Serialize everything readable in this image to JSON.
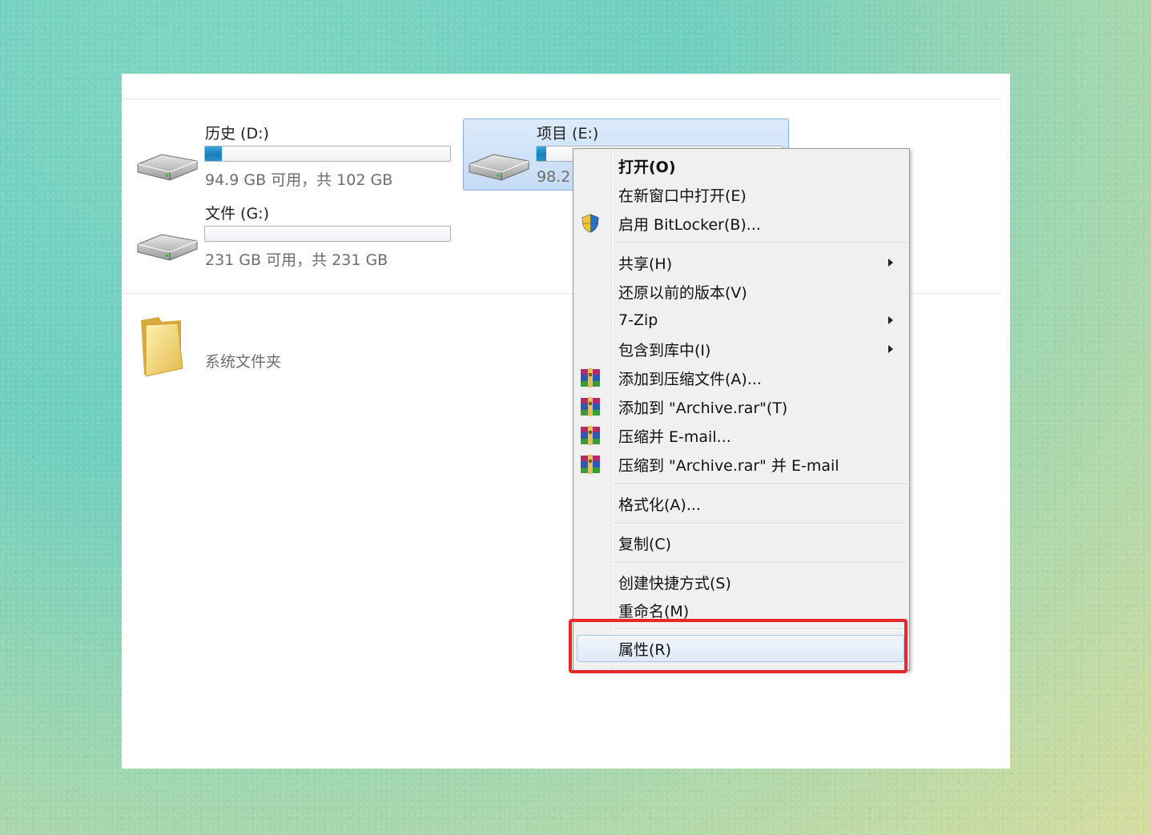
{
  "drives": [
    {
      "id": "d",
      "name": "历史 (D:)",
      "capacity": "94.9 GB 可用，共 102 GB",
      "used_fraction": 0.07
    },
    {
      "id": "g",
      "name": "文件 (G:)",
      "capacity": "231 GB 可用，共 231 GB",
      "used_fraction": 0.0
    },
    {
      "id": "e",
      "name": "项目 (E:)",
      "capacity_partial": "98.2",
      "used_fraction": 0.04,
      "selected": true
    }
  ],
  "folder": {
    "label": "系统文件夹"
  },
  "context_menu": {
    "items": [
      {
        "key": "open",
        "label": "打开(O)",
        "bold": true
      },
      {
        "key": "open_new_window",
        "label": "在新窗口中打开(E)"
      },
      {
        "key": "bitlocker",
        "label": "启用 BitLocker(B)...",
        "icon": "shield-icon"
      },
      {
        "key": "share",
        "label": "共享(H)",
        "submenu": true
      },
      {
        "key": "restore",
        "label": "还原以前的版本(V)"
      },
      {
        "key": "zip",
        "label": "7-Zip",
        "submenu": true
      },
      {
        "key": "library",
        "label": "包含到库中(I)",
        "submenu": true
      },
      {
        "key": "add_archive",
        "label": "添加到压缩文件(A)...",
        "icon": "winrar-icon"
      },
      {
        "key": "add_rar",
        "label": "添加到 \"Archive.rar\"(T)",
        "icon": "winrar-icon"
      },
      {
        "key": "compress_email",
        "label": "压缩并 E-mail...",
        "icon": "winrar-icon"
      },
      {
        "key": "compress_rar_email",
        "label": "压缩到 \"Archive.rar\" 并 E-mail",
        "icon": "winrar-icon"
      },
      {
        "key": "format",
        "label": "格式化(A)..."
      },
      {
        "key": "copy",
        "label": "复制(C)"
      },
      {
        "key": "shortcut",
        "label": "创建快捷方式(S)"
      },
      {
        "key": "rename",
        "label": "重命名(M)"
      },
      {
        "key": "properties",
        "label": "属性(R)",
        "hovered": true
      }
    ]
  },
  "colors": {
    "highlight": "#e8272a",
    "bar_fill": "#1b7fb8",
    "selection": "#c5dcf5"
  }
}
